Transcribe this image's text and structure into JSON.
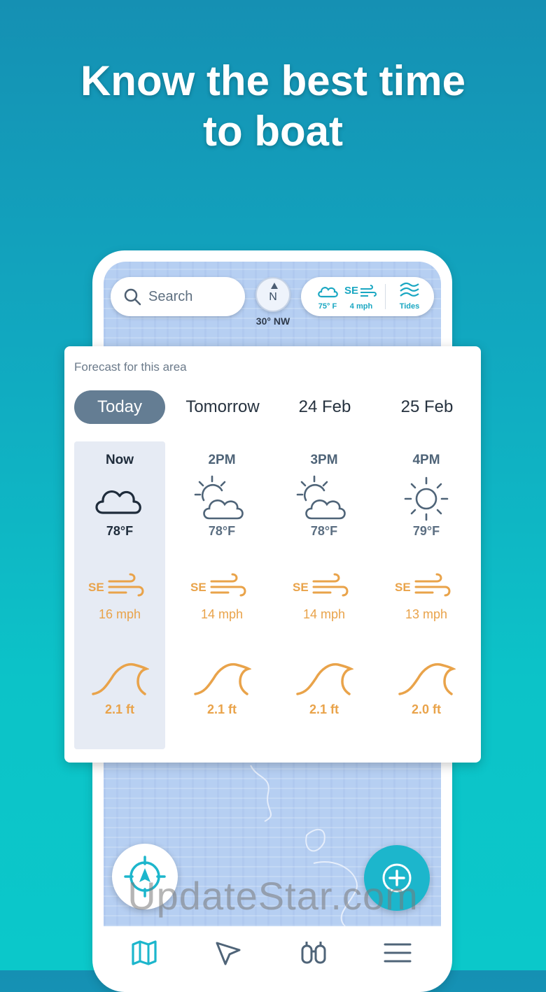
{
  "headline": {
    "line1": "Know the best time",
    "line2": "to boat"
  },
  "map_top": {
    "search_placeholder": "Search",
    "compass_letter": "N",
    "compass_heading": "30° NW",
    "weather_temp": "75° F",
    "weather_wind_dir": "SE",
    "weather_wind_speed": "4 mph",
    "tides_label": "Tides"
  },
  "forecast": {
    "title": "Forecast for this area",
    "days": [
      {
        "label": "Today",
        "active": true
      },
      {
        "label": "Tomorrow",
        "active": false
      },
      {
        "label": "24 Feb",
        "active": false
      },
      {
        "label": "25 Feb",
        "active": false
      }
    ],
    "hours": [
      {
        "time": "Now",
        "icon": "cloud-icon",
        "temp": "78°F",
        "wind_dir": "SE",
        "wind_speed": "16 mph",
        "wave": "2.1 ft"
      },
      {
        "time": "2PM",
        "icon": "partly-cloudy-icon",
        "temp": "78°F",
        "wind_dir": "SE",
        "wind_speed": "14 mph",
        "wave": "2.1 ft"
      },
      {
        "time": "3PM",
        "icon": "partly-cloudy-icon",
        "temp": "78°F",
        "wind_dir": "SE",
        "wind_speed": "14 mph",
        "wave": "2.1 ft"
      },
      {
        "time": "4PM",
        "icon": "sun-icon",
        "temp": "79°F",
        "wind_dir": "SE",
        "wind_speed": "13 mph",
        "wave": "2.0 ft"
      }
    ]
  },
  "bottom_nav": {
    "items": [
      "map-icon",
      "navigate-icon",
      "binoculars-icon",
      "menu-icon"
    ]
  },
  "watermark": "UpdateStar.com",
  "colors": {
    "accent": "#1cb6cc",
    "wind_wave": "#e9a34a",
    "active_tab": "#647d93",
    "map": "#b6cff2"
  }
}
